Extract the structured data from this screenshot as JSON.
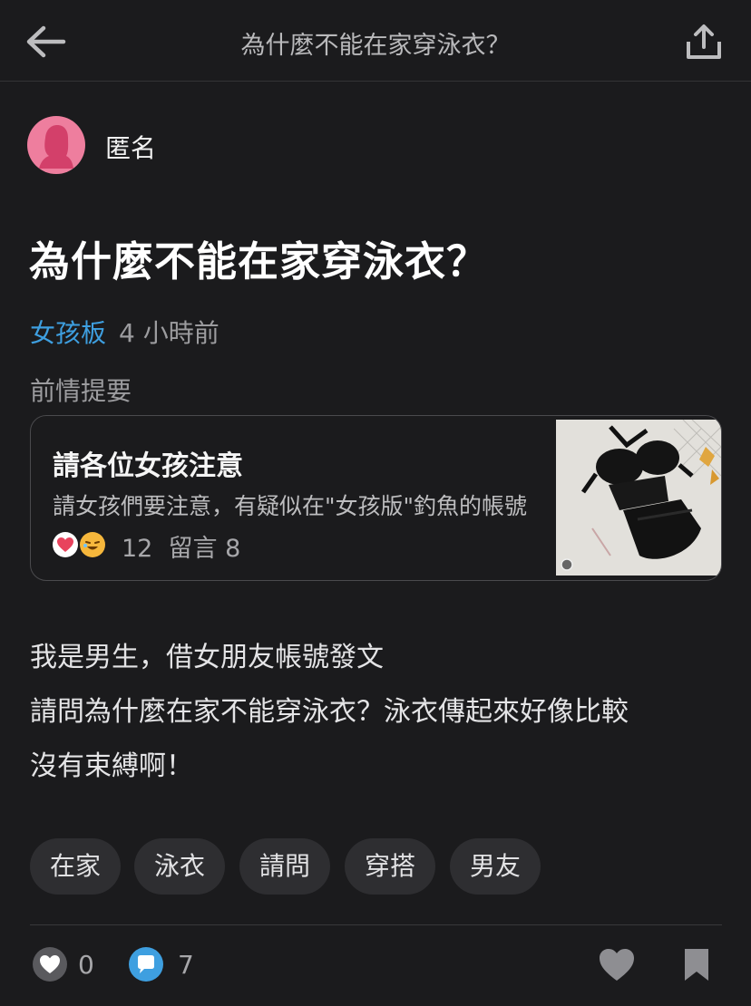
{
  "header": {
    "title": "為什麼不能在家穿泳衣？",
    "back_icon": "arrow-left-icon",
    "share_icon": "share-upload-icon"
  },
  "author": {
    "name": "匿名",
    "avatar_icon": "female-silhouette-icon",
    "avatar_color": "#ee7e9e"
  },
  "post": {
    "title": "為什麼不能在家穿泳衣？",
    "board": "女孩板",
    "time": "4 小時前",
    "recap_label": "前情提要",
    "body": [
      "我是男生，借女朋友帳號發文",
      "請問為什麼在家不能穿泳衣？泳衣傳起來好像比較",
      "沒有束縛啊！"
    ],
    "tags": [
      "在家",
      "泳衣",
      "請問",
      "穿搭",
      "男友"
    ]
  },
  "recap_card": {
    "title": "請各位女孩注意",
    "excerpt": "請女孩們要注意，有疑似在\"女孩版\"釣魚的帳號",
    "reaction_count": "12",
    "comments": "留言 8",
    "thumbnail": "black-swimsuit-photo"
  },
  "footer": {
    "like_count": "0",
    "comment_count": "7",
    "like_icon": "heart-icon",
    "comment_icon": "chat-bubble-icon",
    "bookmark_icon": "bookmark-icon"
  },
  "colors": {
    "background": "#1b1b1d",
    "accent": "#3e9fe0",
    "comment_badge": "#3e9fe0"
  }
}
